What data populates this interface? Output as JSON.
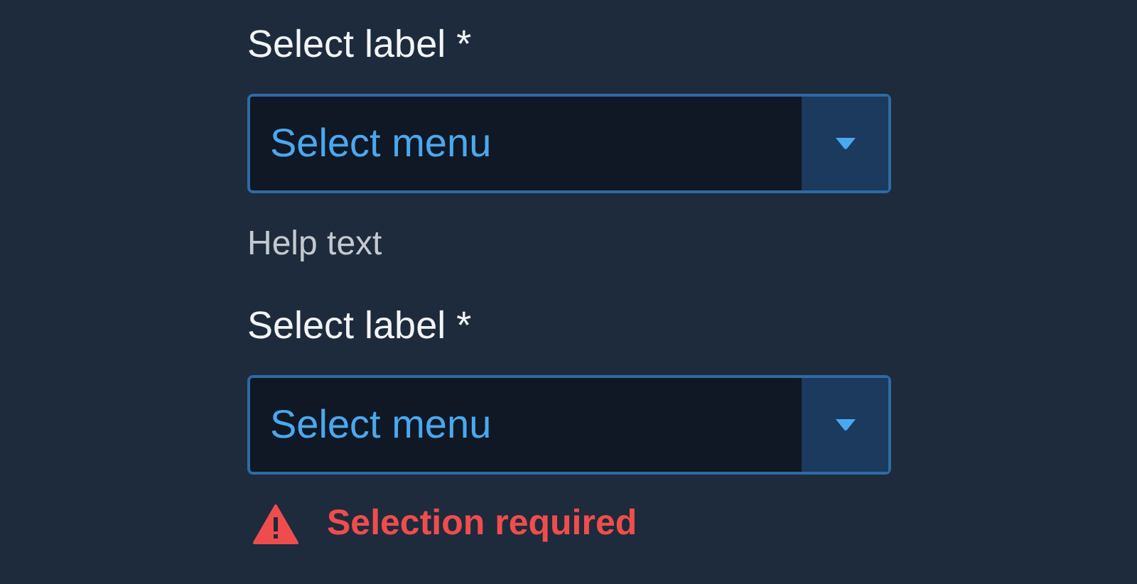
{
  "fields": [
    {
      "label": "Select label *",
      "value": "Select menu",
      "message": {
        "kind": "help",
        "text": "Help text"
      }
    },
    {
      "label": "Select label *",
      "value": "Select menu",
      "message": {
        "kind": "error",
        "text": "Selection required"
      }
    }
  ]
}
